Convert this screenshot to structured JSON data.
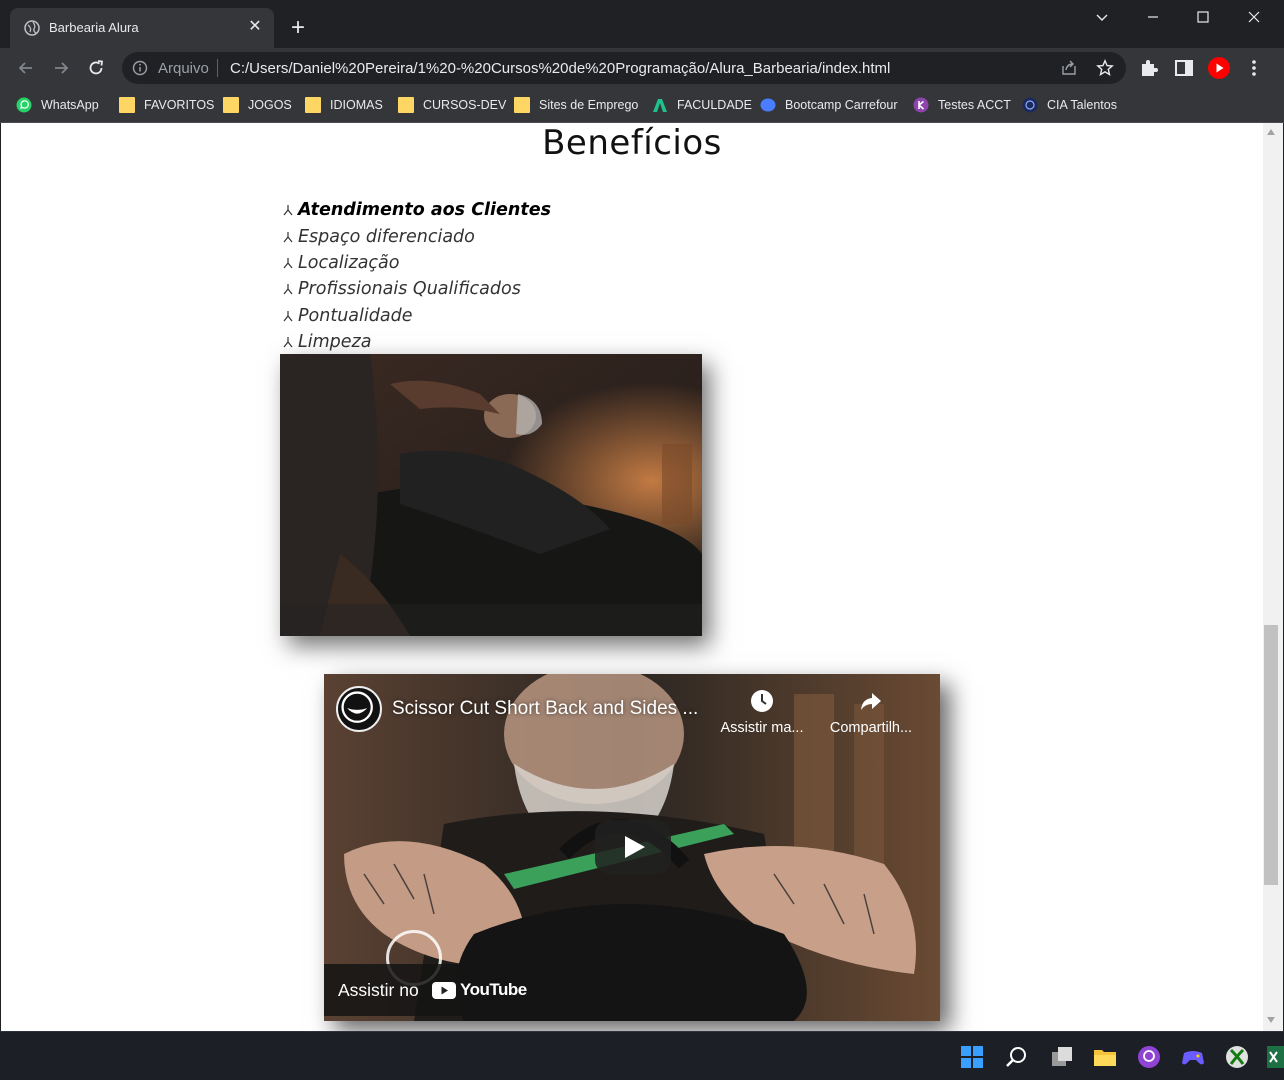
{
  "browser": {
    "tab_title": "Barbearia Alura",
    "tab_close_icon": "close-icon",
    "new_tab_icon": "plus-icon",
    "address": {
      "scheme_label": "Arquivo",
      "url": "C:/Users/Daniel%20Pereira/1%20-%20Cursos%20de%20Programação/Alura_Barbearia/index.html"
    },
    "bookmarks": [
      {
        "label": "WhatsApp",
        "icon": "whatsapp-icon"
      },
      {
        "label": "FAVORITOS",
        "icon": "folder-icon"
      },
      {
        "label": "JOGOS",
        "icon": "folder-icon"
      },
      {
        "label": "IDIOMAS",
        "icon": "folder-icon"
      },
      {
        "label": "CURSOS-DEV",
        "icon": "folder-icon"
      },
      {
        "label": "Sites de Emprego",
        "icon": "folder-icon"
      },
      {
        "label": "FACULDADE",
        "icon": "faculdade-icon"
      },
      {
        "label": "Bootcamp Carrefour",
        "icon": "bootcamp-icon"
      },
      {
        "label": "Testes ACCT",
        "icon": "testes-icon"
      },
      {
        "label": "CIA Talentos",
        "icon": "cia-icon"
      }
    ]
  },
  "page": {
    "heading": "Benefícios",
    "benefits": [
      "Atendimento aos Clientes",
      "Espaço diferenciado",
      "Localização",
      "Profissionais Qualificados",
      "Pontualidade",
      "Limpeza"
    ],
    "video": {
      "title": "Scissor Cut Short Back and Sides ...",
      "watch_later_label": "Assistir ma...",
      "share_label": "Compartilh...",
      "watch_on_label": "Assistir no",
      "brand": "YouTube"
    }
  },
  "colors": {
    "chrome_dark": "#202124",
    "chrome_toolbar": "#35363a",
    "youtube_red": "#ff0000",
    "folder_yellow": "#fdd663"
  }
}
